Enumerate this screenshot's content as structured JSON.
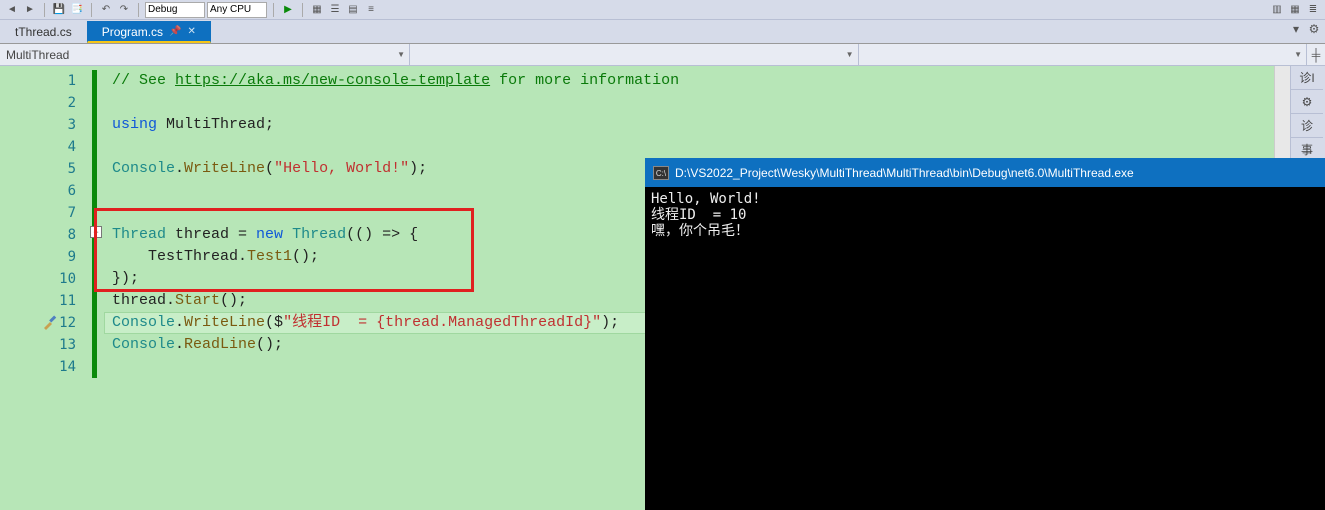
{
  "toolbar": {
    "config1": "Debug",
    "config2": "Any CPU"
  },
  "tabs": {
    "inactive": "tThread.cs",
    "active": "Program.cs"
  },
  "nav": {
    "scope": "MultiThread",
    "empty": ""
  },
  "rightPanel": {
    "label1": "诊I",
    "label2": "诊",
    "label3": "事"
  },
  "gutter": {
    "lines": [
      "1",
      "2",
      "3",
      "4",
      "5",
      "6",
      "7",
      "8",
      "9",
      "10",
      "11",
      "12",
      "13",
      "14"
    ]
  },
  "code": {
    "l1_a": "// See ",
    "l1_link": "https://aka.ms/new-console-template",
    "l1_b": " for more information",
    "l3_using": "using",
    "l3_ns": " MultiThread;",
    "l5_console": "Console",
    "l5_dot": ".",
    "l5_write": "WriteLine",
    "l5_open": "(",
    "l5_str": "\"Hello, World!\"",
    "l5_close": ");",
    "l8_thread1": "Thread",
    "l8_sp1": " thread = ",
    "l8_new": "new",
    "l8_sp2": " ",
    "l8_thread2": "Thread",
    "l8_rest": "(() => {",
    "l9_a": "    TestThread.",
    "l9_m": "Test1",
    "l9_b": "();",
    "l10": "});",
    "l11_a": "thread.",
    "l11_m": "Start",
    "l11_b": "();",
    "l12_a": "Console",
    "l12_b": ".",
    "l12_c": "WriteLine",
    "l12_d": "($",
    "l12_str": "\"线程ID  = {thread.ManagedThreadId}\"",
    "l12_e": ");",
    "l13_a": "Console",
    "l13_b": ".",
    "l13_c": "ReadLine",
    "l13_d": "();"
  },
  "consoleWin": {
    "title": "D:\\VS2022_Project\\Wesky\\MultiThread\\MultiThread\\bin\\Debug\\net6.0\\MultiThread.exe",
    "icon": "C:\\",
    "line1": "Hello, World!",
    "line2": "线程ID  = 10",
    "line3": "嘿，你个吊毛！"
  }
}
